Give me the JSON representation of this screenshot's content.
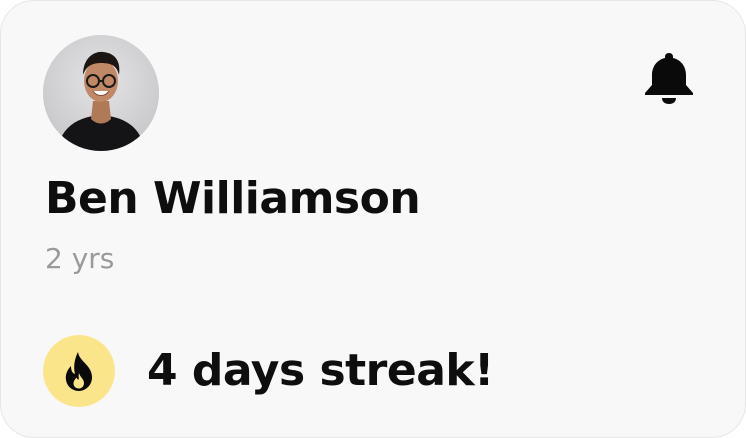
{
  "profile": {
    "name": "Ben Williamson",
    "tenure": "2 yrs",
    "avatar_icon": "person-photo"
  },
  "header": {
    "notification_icon": "bell-icon"
  },
  "streak": {
    "text": "4 days streak!",
    "icon": "fire-icon",
    "badge_color": "#fbe58b"
  }
}
